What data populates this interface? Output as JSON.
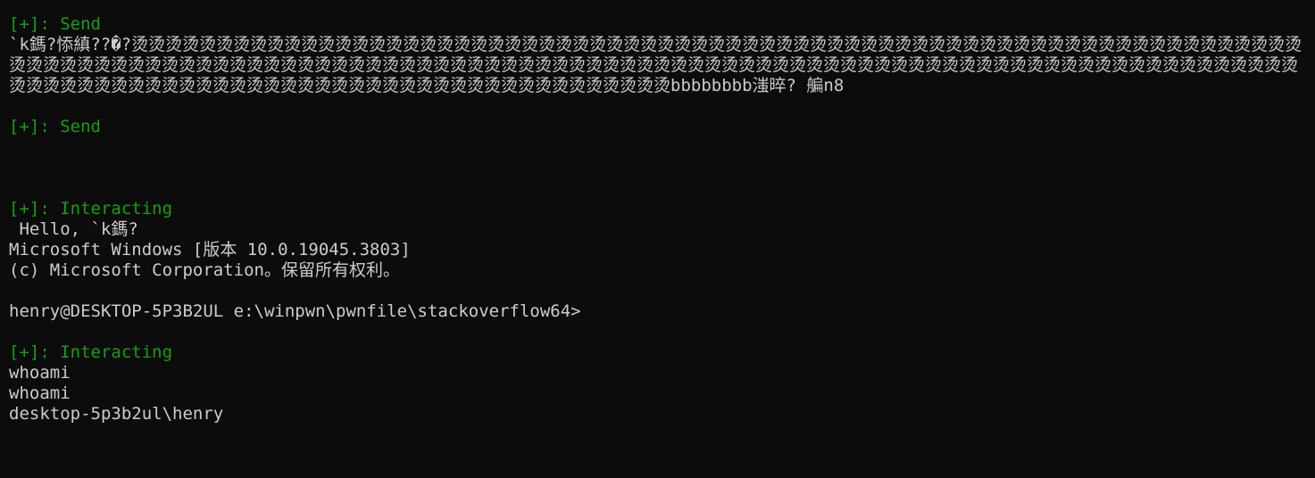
{
  "terminal": {
    "colors": {
      "background": "#0c0c0c",
      "foreground": "#cccccc",
      "status_green": "#13a10e"
    },
    "lines": {
      "send_1": "[+]: Send",
      "payload": "`k鎷?悿縝??�?烫烫烫烫烫烫烫烫烫烫烫烫烫烫烫烫烫烫烫烫烫烫烫烫烫烫烫烫烫烫烫烫烫烫烫烫烫烫烫烫烫烫烫烫烫烫烫烫烫烫烫烫烫烫烫烫烫烫烫烫烫烫烫烫烫烫烫烫烫烫烫烫烫烫烫烫烫烫烫烫烫烫烫烫烫烫烫烫烫烫烫烫烫烫烫烫烫烫烫烫烫烫烫烫烫烫烫烫烫烫烫烫烫烫烫烫烫烫烫烫烫烫烫烫烫烫烫烫烫烫烫烫烫烫烫烫烫烫烫烫烫烫烫烫烫烫烫烫烫烫烫烫烫烫烫烫烫烫烫烫烫烫烫烫烫烫烫烫烫烫烫烫烫烫烫烫烫烫烫烫烫烫烫烫bbbbbbbb滍晬? 艑n8",
      "send_2": "[+]: Send",
      "interacting_1": "[+]: Interacting",
      "hello": " Hello, `k鎷?",
      "windows_version": "Microsoft Windows [版本 10.0.19045.3803]",
      "copyright": "(c) Microsoft Corporation。保留所有权利。",
      "prompt": "henry@DESKTOP-5P3B2UL e:\\winpwn\\pwnfile\\stackoverflow64>",
      "interacting_2": "[+]: Interacting",
      "cmd_1": "whoami",
      "cmd_2": "whoami",
      "result": "desktop-5p3b2ul\\henry"
    }
  }
}
